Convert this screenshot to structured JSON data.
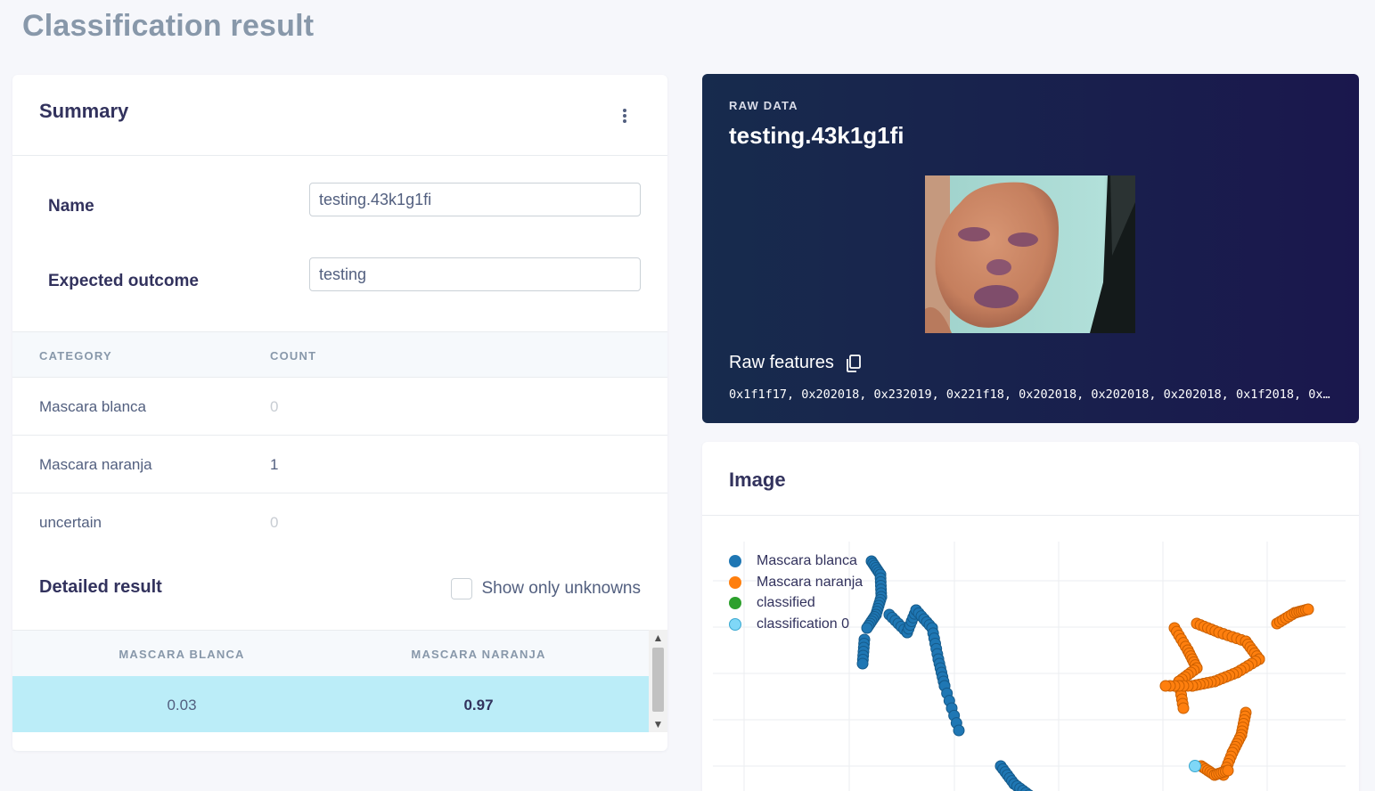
{
  "page": {
    "title": "Classification result"
  },
  "summary": {
    "title": "Summary",
    "fields": {
      "name_label": "Name",
      "name_value": "testing.43k1g1fi",
      "expected_label": "Expected outcome",
      "expected_value": "testing"
    },
    "table": {
      "headers": [
        "CATEGORY",
        "COUNT"
      ],
      "rows": [
        {
          "category": "Mascara blanca",
          "count": "0"
        },
        {
          "category": "Mascara naranja",
          "count": "1"
        },
        {
          "category": "uncertain",
          "count": "0"
        }
      ]
    },
    "detailed": {
      "title": "Detailed result",
      "checkbox_label": "Show only unknowns",
      "headers": [
        "MASCARA BLANCA",
        "MASCARA NARANJA"
      ],
      "rows": [
        {
          "blanca": "0.03",
          "naranja": "0.97"
        }
      ]
    }
  },
  "raw": {
    "eyebrow": "RAW DATA",
    "title": "testing.43k1g1fi",
    "features_label": "Raw features",
    "features_values": "0x1f1f17, 0x202018, 0x232019, 0x221f18, 0x202018, 0x202018, 0x202018, 0x1f2018, 0x2…"
  },
  "image_card": {
    "title": "Image",
    "legend": [
      {
        "label": "Mascara blanca",
        "color": "#1f77b4"
      },
      {
        "label": "Mascara naranja",
        "color": "#ff7f0e"
      },
      {
        "label": "classified",
        "color": "#2ca02c"
      },
      {
        "label": "classification 0",
        "color": "#7fd7f7"
      }
    ]
  },
  "colors": {
    "accent_row": "#bbedf8",
    "raw_bg": "#172b4d"
  }
}
